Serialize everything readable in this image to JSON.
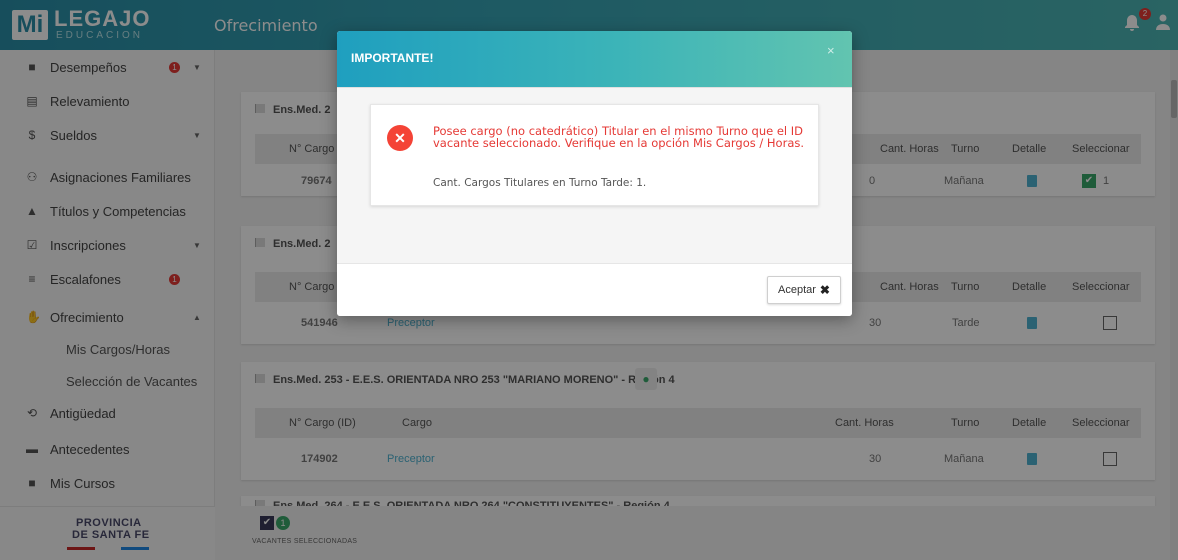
{
  "header": {
    "logo_mi": "Mi",
    "logo_legajo": "LEGAJO",
    "logo_sub": "EDUCACION",
    "section_title": "Ofrecimiento",
    "notification_count": "2"
  },
  "sidebar": {
    "items": [
      {
        "label": "Desempeños",
        "icon": "briefcase-icon",
        "badge": "1",
        "caret": "down"
      },
      {
        "label": "Relevamiento",
        "icon": "clipboard-icon"
      },
      {
        "label": "Sueldos",
        "icon": "dollar-icon",
        "caret": "down"
      },
      {
        "label": "Asignaciones Familiares",
        "icon": "family-icon"
      },
      {
        "label": "Títulos y Competencias",
        "icon": "graduation-cap-icon"
      },
      {
        "label": "Inscripciones",
        "icon": "checkbox-icon",
        "caret": "down"
      },
      {
        "label": "Escalafones",
        "icon": "list-icon",
        "badge": "1"
      },
      {
        "label": "Ofrecimiento",
        "icon": "handshake-icon",
        "caret": "up"
      },
      {
        "label": "Antigüedad",
        "icon": "history-icon"
      },
      {
        "label": "Antecedentes",
        "icon": "folder-icon"
      },
      {
        "label": "Mis Cursos",
        "icon": "book-icon"
      }
    ],
    "subitems": [
      "Mis Cargos/Horas",
      "Selección de Vacantes"
    ],
    "footer_line1": "PROVINCIA",
    "footer_line2": "DE SANTA FE"
  },
  "main": {
    "columns": {
      "id": "N° Cargo (ID)",
      "cargo": "Cargo",
      "horas": "Cant. Horas",
      "turno": "Turno",
      "detalle": "Detalle",
      "seleccionar": "Seleccionar"
    },
    "panels": [
      {
        "title": "Ens.Med. 2",
        "row": {
          "id": "79674",
          "cargo": "",
          "horas": "0",
          "turno": "Mañana",
          "selected": true,
          "sel_num": "1"
        }
      },
      {
        "title": "Ens.Med. 2",
        "row": {
          "id": "541946",
          "cargo": "Preceptor",
          "horas": "30",
          "turno": "Tarde",
          "selected": false
        }
      },
      {
        "title": "Ens.Med. 253 - E.E.S. ORIENTADA NRO 253 \"MARIANO MORENO\" - Región 4",
        "row": {
          "id": "174902",
          "cargo": "Preceptor",
          "horas": "30",
          "turno": "Mañana",
          "selected": false
        }
      },
      {
        "title": "Ens.Med. 264 - E.E.S. ORIENTADA NRO 264 \"CONSTITUYENTES\" - Región 4"
      }
    ],
    "bottom": {
      "count": "1",
      "label": "VACANTES SELECCIONADAS"
    }
  },
  "modal": {
    "title": "IMPORTANTE!",
    "close": "×",
    "message": "Posee cargo (no catedrático) Titular en el mismo Turno que el ID vacante seleccionado. Verifique en la opción Mis Cargos / Horas.",
    "detail": "Cant. Cargos Titulares en Turno Tarde: 1.",
    "accept_label": "Aceptar",
    "accept_icon": "✖"
  },
  "colors": {
    "header": "#2a8fa8",
    "accent_green": "#3aa86b",
    "error_red": "#e53935",
    "link_blue": "#4fb3d1"
  }
}
